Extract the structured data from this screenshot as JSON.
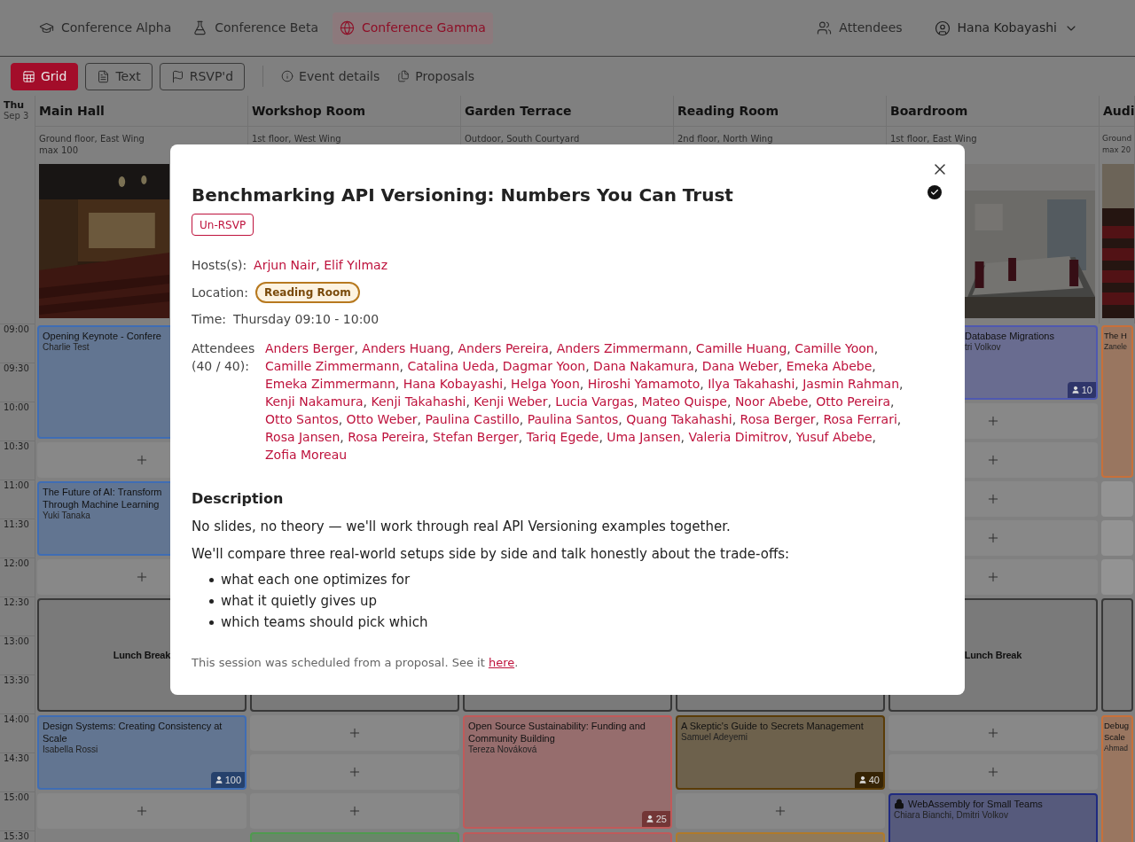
{
  "nav": {
    "conferences": [
      {
        "label": "Conference Alpha",
        "selected": false
      },
      {
        "label": "Conference Beta",
        "selected": false
      },
      {
        "label": "Conference Gamma",
        "selected": true
      }
    ],
    "attendees_link": "Attendees",
    "user_menu": "Hana Kobayashi"
  },
  "toolbar": {
    "views": [
      {
        "label": "Grid",
        "selected": true
      },
      {
        "label": "Text",
        "selected": false
      },
      {
        "label": "RSVP'd",
        "selected": false
      }
    ],
    "links": [
      "Event details",
      "Proposals"
    ]
  },
  "grid": {
    "day": "Thu",
    "date": "Sep 3",
    "times": [
      "09:00",
      "09:30",
      "10:00",
      "10:30",
      "11:00",
      "11:30",
      "12:00",
      "12:30",
      "13:00",
      "13:30",
      "14:00",
      "14:30",
      "15:00",
      "15:30"
    ],
    "rooms": [
      {
        "name": "Main Hall",
        "location": "Ground floor, East Wing",
        "capacity": "max 100",
        "image": {
          "kind": "picture"
        },
        "slots": [
          {
            "kind": "session",
            "title": "Opening Keynote - Confere",
            "speakers": "Charlie Test",
            "color": "#3f6db4"
          },
          {
            "kind": "empty"
          },
          {
            "kind": "session",
            "title": "The Future of AI: Transform\nThrough Machine Learning",
            "speakers": "Yuki Tanaka",
            "color": "#3f6db4"
          },
          {
            "kind": "empty"
          },
          {
            "kind": "break",
            "title": "Lunch Break"
          },
          {
            "kind": "session",
            "title": "Design Systems: Creating Consistency at Scale",
            "speakers": "Isabella Rossi",
            "count": "100",
            "color": "#3f6db4"
          },
          {
            "kind": "empty"
          }
        ]
      },
      {
        "name": "Workshop Room",
        "location": "1st floor, West Wing",
        "slots": [
          {
            "kind": "break"
          },
          {
            "kind": "empty"
          },
          {
            "kind": "empty"
          },
          {
            "kind": "empty"
          },
          {
            "kind": "partial",
            "color": "#4f9a4f"
          }
        ]
      },
      {
        "name": "Garden Terrace",
        "location": "Outdoor, South Courtyard",
        "slots": [
          {
            "kind": "break"
          },
          {
            "kind": "session",
            "title": "Open Source Sustainability: Funding and Community Building",
            "speakers": "Tereza Nováková",
            "count": "25",
            "color": "#c05a5a"
          },
          {
            "kind": "partial",
            "color": "#c05a5a"
          }
        ]
      },
      {
        "name": "Reading Room",
        "location": "2nd floor, North Wing",
        "slots": [
          {
            "kind": "break"
          },
          {
            "kind": "session",
            "title": "A Skeptic's Guide to Secrets Management",
            "speakers": "Samuel Adeyemi",
            "count": "40",
            "color": "#5a3c08"
          },
          {
            "kind": "empty"
          },
          {
            "kind": "partial",
            "color": "#b07a2a"
          }
        ]
      },
      {
        "name": "Boardroom",
        "location": "1st floor, East Wing",
        "image": {
          "kind": "picture"
        },
        "slots": [
          {
            "kind": "clipped",
            "title": "Database Migrations",
            "speakers": "tri Volkov",
            "count": "10",
            "color": "#4f58b0"
          },
          {
            "kind": "empty"
          },
          {
            "kind": "empty"
          },
          {
            "kind": "empty"
          },
          {
            "kind": "empty"
          },
          {
            "kind": "empty"
          },
          {
            "kind": "break",
            "title": "Lunch Break"
          },
          {
            "kind": "empty"
          },
          {
            "kind": "empty"
          },
          {
            "kind": "session",
            "title": "WebAssembly for Small Teams",
            "speakers": "Chiara Bianchi, Dmitri Volkov",
            "locked": true,
            "color": "#1f2a80"
          }
        ]
      },
      {
        "name": "Audi",
        "location": "Ground",
        "capacity": "max 20",
        "image": {
          "kind": "picture"
        },
        "slots": [
          {
            "kind": "session",
            "title": "The H",
            "speakers": "Zanele",
            "color": "#c8703a"
          },
          {
            "kind": "blank"
          },
          {
            "kind": "blank"
          },
          {
            "kind": "blank"
          },
          {
            "kind": "break"
          },
          {
            "kind": "session",
            "title": "Debug\nScale",
            "speakers": "Ahmad",
            "color": "#c8703a"
          }
        ]
      }
    ]
  },
  "modal": {
    "title": "Benchmarking API Versioning: Numbers You Can Trust",
    "rsvped": true,
    "rsvp_button": "Un-RSVP",
    "separator": ", ",
    "hosts_label": "Hosts(s):",
    "hosts": [
      "Arjun Nair",
      "Elif Yılmaz"
    ],
    "location_label": "Location:",
    "location": "Reading Room",
    "time_label": "Time:",
    "time": "Thursday 09:10 - 10:00",
    "attendees_label": "Attendees",
    "attendees_count": "(40 / 40):",
    "attendees": [
      "Anders Berger",
      "Anders Huang",
      "Anders Pereira",
      "Anders Zimmermann",
      "Camille Huang",
      "Camille Yoon",
      "Camille Zimmermann",
      "Catalina Ueda",
      "Dagmar Yoon",
      "Dana Nakamura",
      "Dana Weber",
      "Emeka Abebe",
      "Emeka Zimmermann",
      "Hana Kobayashi",
      "Helga Yoon",
      "Hiroshi Yamamoto",
      "Ilya Takahashi",
      "Jasmin Rahman",
      "Kenji Nakamura",
      "Kenji Takahashi",
      "Kenji Weber",
      "Lucia Vargas",
      "Mateo Quispe",
      "Noor Abebe",
      "Otto Pereira",
      "Otto Santos",
      "Otto Weber",
      "Paulina Castillo",
      "Paulina Santos",
      "Quang Takahashi",
      "Rosa Berger",
      "Rosa Ferrari",
      "Rosa Jansen",
      "Rosa Pereira",
      "Stefan Berger",
      "Tariq Egede",
      "Uma Jansen",
      "Valeria Dimitrov",
      "Yusuf Abebe",
      "Zofia Moreau"
    ],
    "description_heading": "Description",
    "paragraphs": [
      "No slides, no theory — we'll work through real API Versioning examples together.",
      "We'll compare three real-world setups side by side and talk honestly about the trade-offs:"
    ],
    "bullets": [
      "what each one optimizes for",
      "what it quietly gives up",
      "which teams should pick which"
    ],
    "footer": {
      "text": "This session was scheduled from a proposal. See it ",
      "link": "here",
      "end": "."
    }
  }
}
